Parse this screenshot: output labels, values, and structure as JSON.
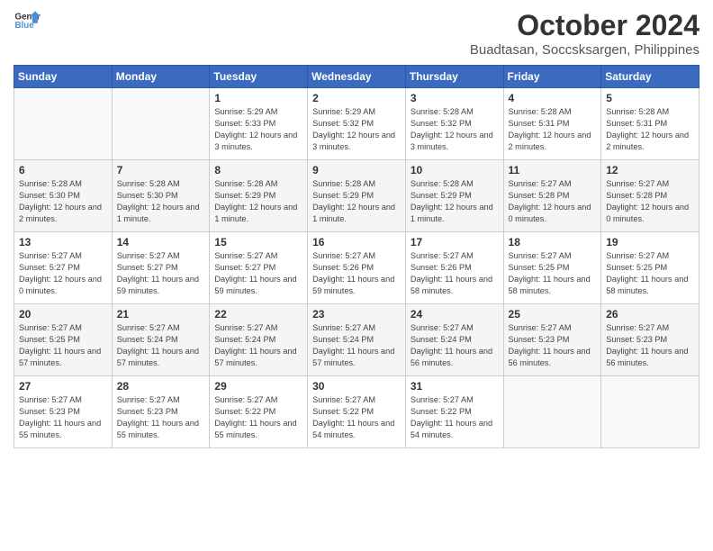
{
  "logo": {
    "line1": "General",
    "line2": "Blue"
  },
  "title": "October 2024",
  "location": "Buadtasan, Soccsksargen, Philippines",
  "weekdays": [
    "Sunday",
    "Monday",
    "Tuesday",
    "Wednesday",
    "Thursday",
    "Friday",
    "Saturday"
  ],
  "weeks": [
    [
      null,
      null,
      {
        "day": 1,
        "sunrise": "5:29 AM",
        "sunset": "5:33 PM",
        "daylight": "12 hours and 3 minutes."
      },
      {
        "day": 2,
        "sunrise": "5:29 AM",
        "sunset": "5:32 PM",
        "daylight": "12 hours and 3 minutes."
      },
      {
        "day": 3,
        "sunrise": "5:28 AM",
        "sunset": "5:32 PM",
        "daylight": "12 hours and 3 minutes."
      },
      {
        "day": 4,
        "sunrise": "5:28 AM",
        "sunset": "5:31 PM",
        "daylight": "12 hours and 2 minutes."
      },
      {
        "day": 5,
        "sunrise": "5:28 AM",
        "sunset": "5:31 PM",
        "daylight": "12 hours and 2 minutes."
      }
    ],
    [
      {
        "day": 6,
        "sunrise": "5:28 AM",
        "sunset": "5:30 PM",
        "daylight": "12 hours and 2 minutes."
      },
      {
        "day": 7,
        "sunrise": "5:28 AM",
        "sunset": "5:30 PM",
        "daylight": "12 hours and 1 minute."
      },
      {
        "day": 8,
        "sunrise": "5:28 AM",
        "sunset": "5:29 PM",
        "daylight": "12 hours and 1 minute."
      },
      {
        "day": 9,
        "sunrise": "5:28 AM",
        "sunset": "5:29 PM",
        "daylight": "12 hours and 1 minute."
      },
      {
        "day": 10,
        "sunrise": "5:28 AM",
        "sunset": "5:29 PM",
        "daylight": "12 hours and 1 minute."
      },
      {
        "day": 11,
        "sunrise": "5:27 AM",
        "sunset": "5:28 PM",
        "daylight": "12 hours and 0 minutes."
      },
      {
        "day": 12,
        "sunrise": "5:27 AM",
        "sunset": "5:28 PM",
        "daylight": "12 hours and 0 minutes."
      }
    ],
    [
      {
        "day": 13,
        "sunrise": "5:27 AM",
        "sunset": "5:27 PM",
        "daylight": "12 hours and 0 minutes."
      },
      {
        "day": 14,
        "sunrise": "5:27 AM",
        "sunset": "5:27 PM",
        "daylight": "11 hours and 59 minutes."
      },
      {
        "day": 15,
        "sunrise": "5:27 AM",
        "sunset": "5:27 PM",
        "daylight": "11 hours and 59 minutes."
      },
      {
        "day": 16,
        "sunrise": "5:27 AM",
        "sunset": "5:26 PM",
        "daylight": "11 hours and 59 minutes."
      },
      {
        "day": 17,
        "sunrise": "5:27 AM",
        "sunset": "5:26 PM",
        "daylight": "11 hours and 58 minutes."
      },
      {
        "day": 18,
        "sunrise": "5:27 AM",
        "sunset": "5:25 PM",
        "daylight": "11 hours and 58 minutes."
      },
      {
        "day": 19,
        "sunrise": "5:27 AM",
        "sunset": "5:25 PM",
        "daylight": "11 hours and 58 minutes."
      }
    ],
    [
      {
        "day": 20,
        "sunrise": "5:27 AM",
        "sunset": "5:25 PM",
        "daylight": "11 hours and 57 minutes."
      },
      {
        "day": 21,
        "sunrise": "5:27 AM",
        "sunset": "5:24 PM",
        "daylight": "11 hours and 57 minutes."
      },
      {
        "day": 22,
        "sunrise": "5:27 AM",
        "sunset": "5:24 PM",
        "daylight": "11 hours and 57 minutes."
      },
      {
        "day": 23,
        "sunrise": "5:27 AM",
        "sunset": "5:24 PM",
        "daylight": "11 hours and 57 minutes."
      },
      {
        "day": 24,
        "sunrise": "5:27 AM",
        "sunset": "5:24 PM",
        "daylight": "11 hours and 56 minutes."
      },
      {
        "day": 25,
        "sunrise": "5:27 AM",
        "sunset": "5:23 PM",
        "daylight": "11 hours and 56 minutes."
      },
      {
        "day": 26,
        "sunrise": "5:27 AM",
        "sunset": "5:23 PM",
        "daylight": "11 hours and 56 minutes."
      }
    ],
    [
      {
        "day": 27,
        "sunrise": "5:27 AM",
        "sunset": "5:23 PM",
        "daylight": "11 hours and 55 minutes."
      },
      {
        "day": 28,
        "sunrise": "5:27 AM",
        "sunset": "5:23 PM",
        "daylight": "11 hours and 55 minutes."
      },
      {
        "day": 29,
        "sunrise": "5:27 AM",
        "sunset": "5:22 PM",
        "daylight": "11 hours and 55 minutes."
      },
      {
        "day": 30,
        "sunrise": "5:27 AM",
        "sunset": "5:22 PM",
        "daylight": "11 hours and 54 minutes."
      },
      {
        "day": 31,
        "sunrise": "5:27 AM",
        "sunset": "5:22 PM",
        "daylight": "11 hours and 54 minutes."
      },
      null,
      null
    ]
  ]
}
